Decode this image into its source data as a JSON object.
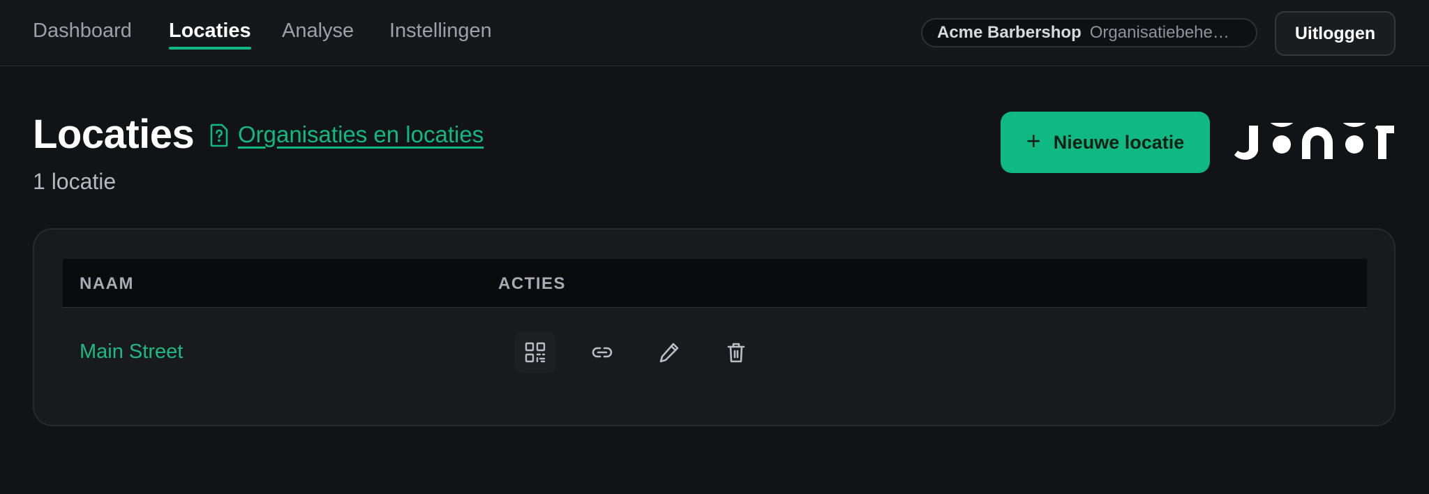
{
  "nav": {
    "tabs": [
      {
        "label": "Dashboard"
      },
      {
        "label": "Locaties",
        "active": true
      },
      {
        "label": "Analyse"
      },
      {
        "label": "Instellingen"
      }
    ],
    "org": {
      "name": "Acme Barbershop",
      "role": "Organisatiebeheerder"
    },
    "logout_label": "Uitloggen"
  },
  "header": {
    "title": "Locaties",
    "help_icon": "help-document-icon",
    "help_link": "Organisaties en locaties",
    "count": "1 locatie",
    "new_button_label": "Nieuwe locatie",
    "new_button_icon": "plus-icon",
    "brand": "JONOT"
  },
  "table": {
    "columns": [
      "NAAM",
      "ACTIES"
    ],
    "rows": [
      {
        "name": "Main Street",
        "actions": [
          "qr-code-icon",
          "link-icon",
          "edit-pencil-icon",
          "trash-icon"
        ]
      }
    ]
  },
  "colors": {
    "background": "#111317",
    "accent": "#10b981",
    "card": "#181a1e",
    "table_header": "#0a0b0d"
  }
}
